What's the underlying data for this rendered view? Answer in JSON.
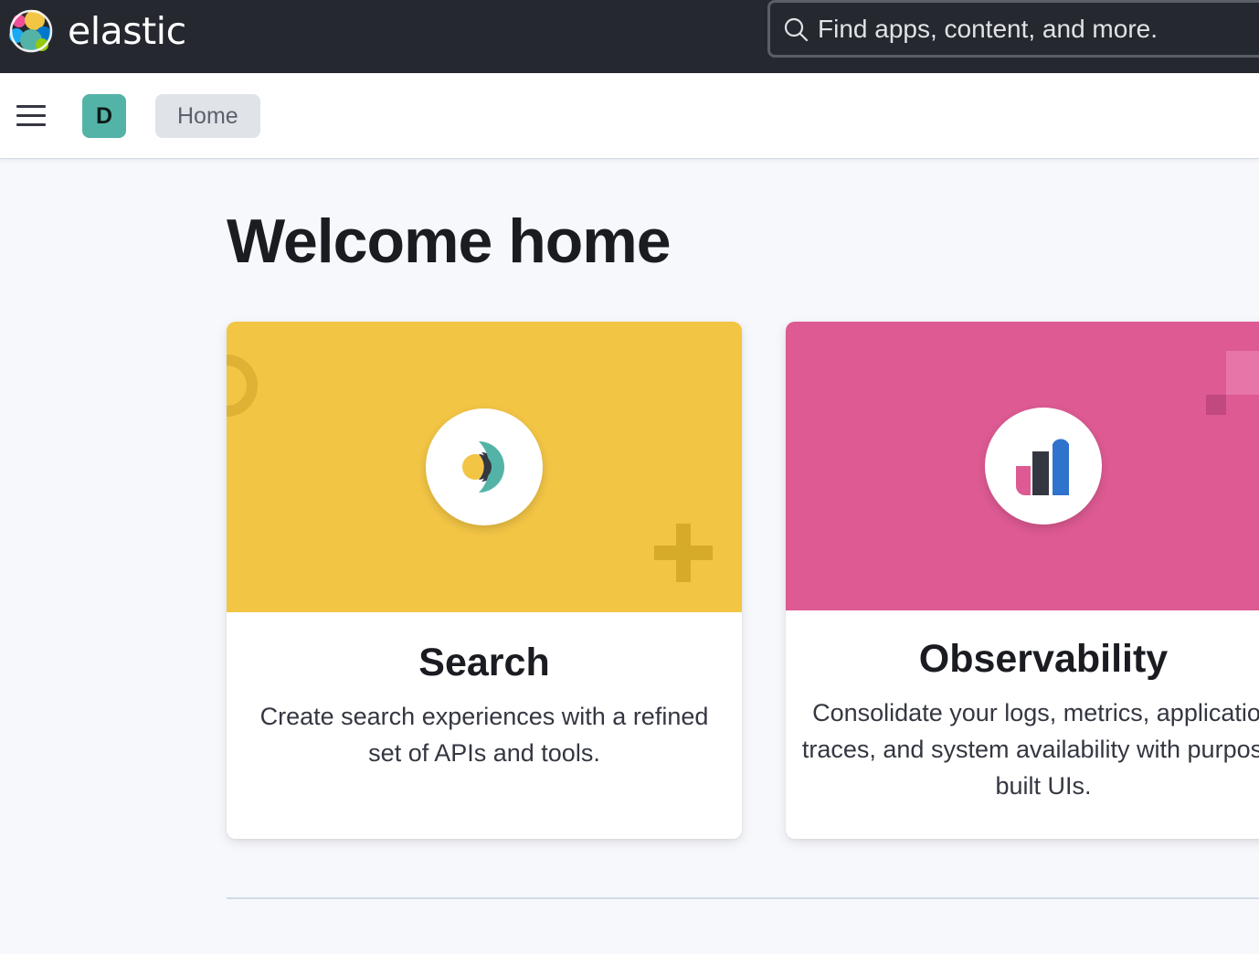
{
  "header": {
    "brand_name": "elastic",
    "logo_icon": "elastic-logo-icon",
    "search_placeholder": "Find apps, content, and more.",
    "search_icon": "search-icon",
    "background": "#25282f"
  },
  "subheader": {
    "menu_icon": "hamburger-menu-icon",
    "space_avatar_letter": "D",
    "space_avatar_color": "#54b3a7",
    "breadcrumb": "Home"
  },
  "main": {
    "title": "Welcome home",
    "cards": [
      {
        "title": "Search",
        "description": "Create search experiences with a refined set of APIs and tools.",
        "banner_color": "#f2c545",
        "icon": "enterprise-search-icon"
      },
      {
        "title": "Observability",
        "description": "Consolidate your logs, metrics, application traces, and system availability with purpose-built UIs.",
        "banner_color": "#dd5a92",
        "icon": "observability-icon"
      }
    ]
  }
}
